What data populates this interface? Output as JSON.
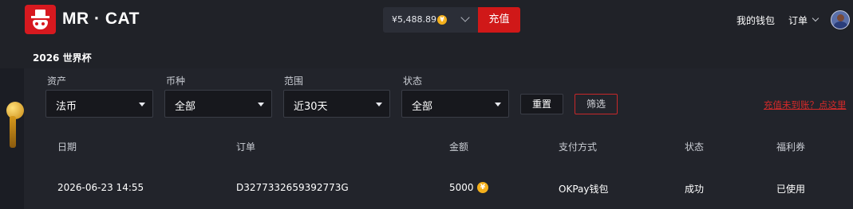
{
  "header": {
    "brand": "MR · CAT",
    "section_title": "2026 世界杯",
    "balance": "¥5,488.89",
    "coin_symbol": "¥",
    "recharge_label": "充值",
    "nav_wallet": "我的钱包",
    "nav_orders": "订单"
  },
  "filters": {
    "asset": {
      "label": "资产",
      "value": "法币"
    },
    "currency": {
      "label": "币种",
      "value": "全部"
    },
    "range": {
      "label": "范围",
      "value": "近30天"
    },
    "status": {
      "label": "状态",
      "value": "全部"
    },
    "reset_label": "重置",
    "filter_label": "筛选",
    "help_link": "充值未到账？点这里"
  },
  "table": {
    "headers": [
      "日期",
      "订单",
      "金额",
      "支付方式",
      "状态",
      "福利券"
    ],
    "rows": [
      {
        "date": "2026-06-23 14:55",
        "order": "D3277332659392773G",
        "amount": "5000",
        "coin_symbol": "¥",
        "payment": "OKPay钱包",
        "status": "成功",
        "coupon": "已使用"
      }
    ]
  },
  "colors": {
    "accent_red": "#d01818",
    "coin_gold": "#f4b01c",
    "background": "#1b1d24"
  }
}
